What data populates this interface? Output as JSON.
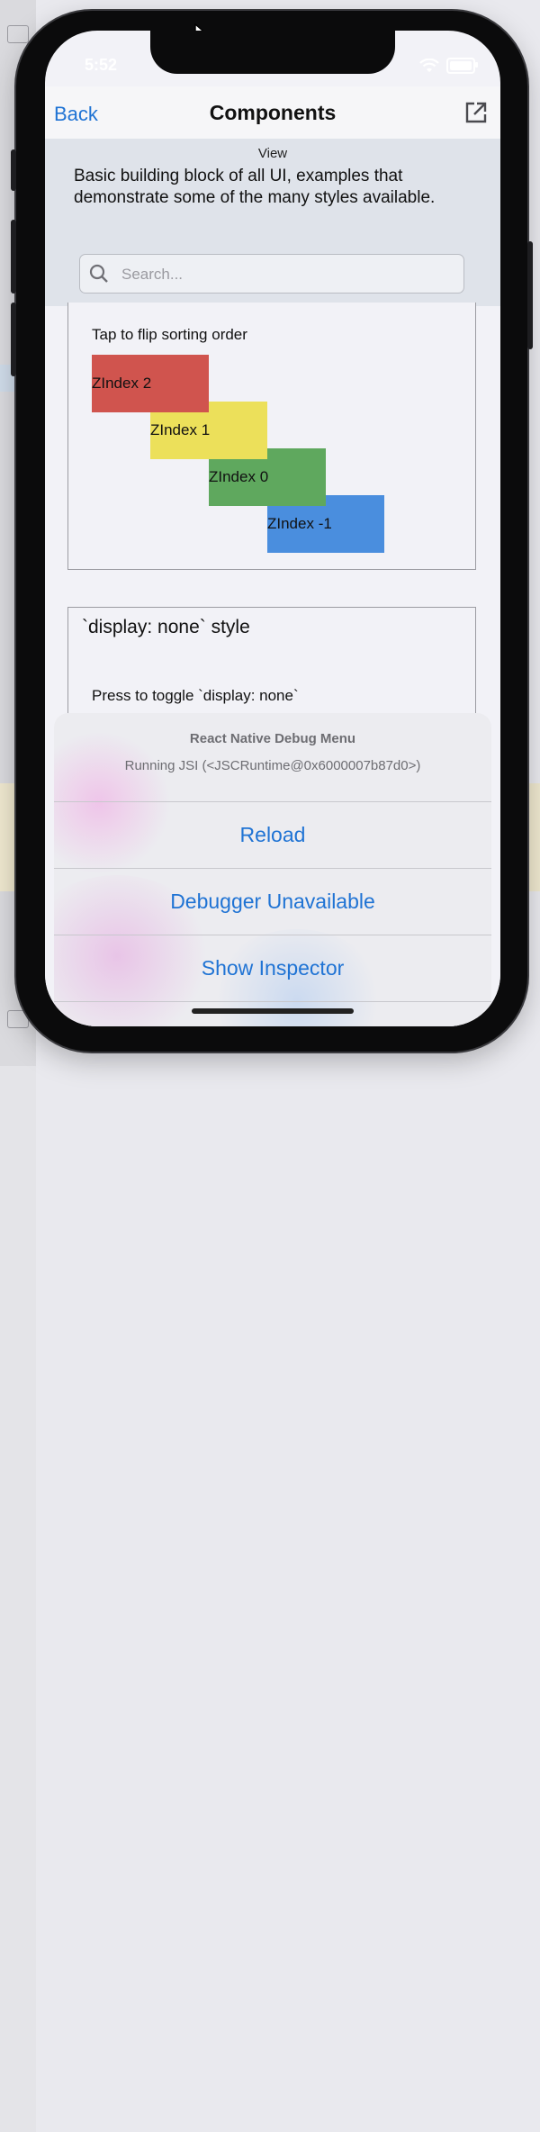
{
  "status_bar": {
    "time": "5:52"
  },
  "navbar": {
    "back_label": "Back",
    "title": "Components",
    "open_icon": "external-link-icon"
  },
  "header": {
    "section_label": "View",
    "description": "Basic building block of all UI, examples that demonstrate some of the many styles available.",
    "search_placeholder": "Search..."
  },
  "zindex_card": {
    "instruction": "Tap to flip sorting order",
    "boxes": [
      {
        "label": "ZIndex 2",
        "color": "#d0544e"
      },
      {
        "label": "ZIndex 1",
        "color": "#ece05a"
      },
      {
        "label": "ZIndex 0",
        "color": "#5fa85e"
      },
      {
        "label": "ZIndex -1",
        "color": "#4a8ede"
      }
    ]
  },
  "display_card": {
    "title": "`display: none` style",
    "instruction": "Press to toggle `display: none`"
  },
  "debug_menu": {
    "title": "React Native Debug Menu",
    "message": "Running JSI (<JSCRuntime@0x6000007b87d0>)",
    "actions": [
      "Reload",
      "Debugger Unavailable",
      "Show Inspector"
    ]
  },
  "colors": {
    "accent": "#1f73d4"
  }
}
